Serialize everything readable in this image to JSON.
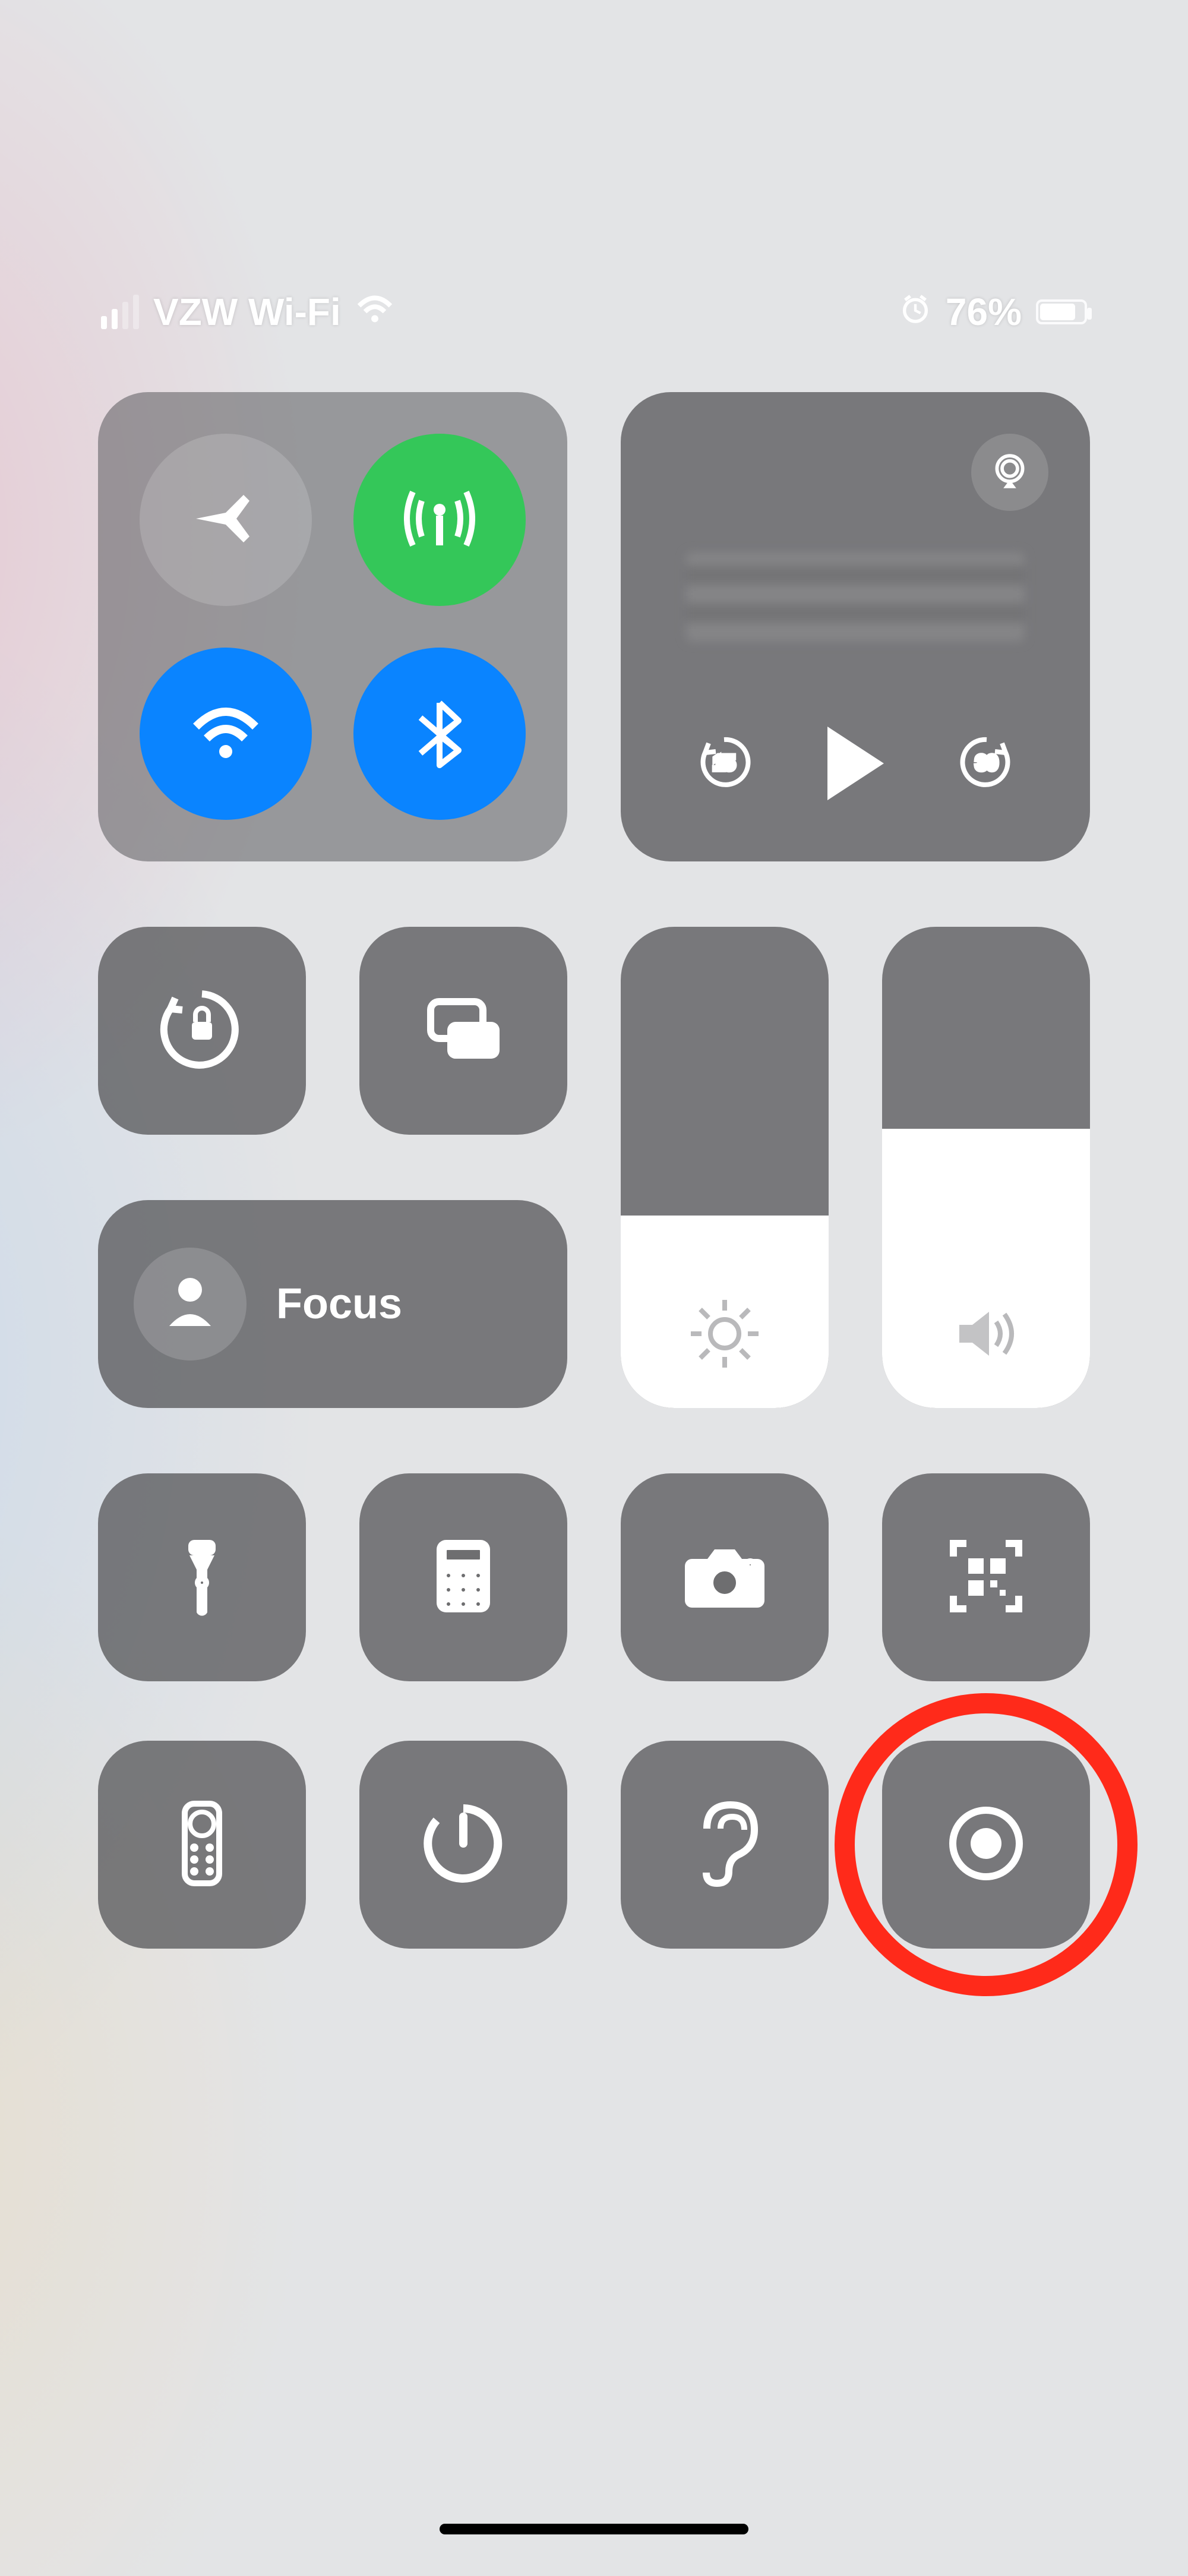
{
  "status_bar": {
    "carrier": "VZW Wi-Fi",
    "signal_active_bars": 2,
    "alarm_set": true,
    "battery_percent_text": "76%",
    "battery_level": 76
  },
  "connectivity": {
    "airplane_mode": {
      "icon": "airplane-icon",
      "active": false
    },
    "cellular_data": {
      "icon": "antenna-icon",
      "active": true,
      "color": "#34c759"
    },
    "wifi": {
      "icon": "wifi-icon",
      "active": true,
      "color": "#0a84ff"
    },
    "bluetooth": {
      "icon": "bluetooth-icon",
      "active": true,
      "color": "#0a84ff"
    }
  },
  "media": {
    "airplay_icon": "airplay-icon",
    "back_seconds": 15,
    "forward_seconds": 30,
    "playing": false,
    "title_redacted": true
  },
  "toggles": {
    "rotation_lock": "rotation-lock-icon",
    "screen_mirroring": "screen-mirroring-icon"
  },
  "focus": {
    "icon": "person-icon",
    "label": "Focus"
  },
  "sliders": {
    "brightness": {
      "level": 0.4,
      "icon": "sun-icon"
    },
    "volume": {
      "level": 0.58,
      "icon": "speaker-icon"
    }
  },
  "utilities_row1": [
    "flashlight-icon",
    "calculator-icon",
    "camera-icon",
    "qr-code-scanner-icon"
  ],
  "utilities_row2": [
    "apple-tv-remote-icon",
    "timer-icon",
    "hearing-icon",
    "screen-record-icon"
  ],
  "annotation": {
    "circled_icon": "screen-record-icon",
    "circle_color": "#ff2a1a"
  }
}
